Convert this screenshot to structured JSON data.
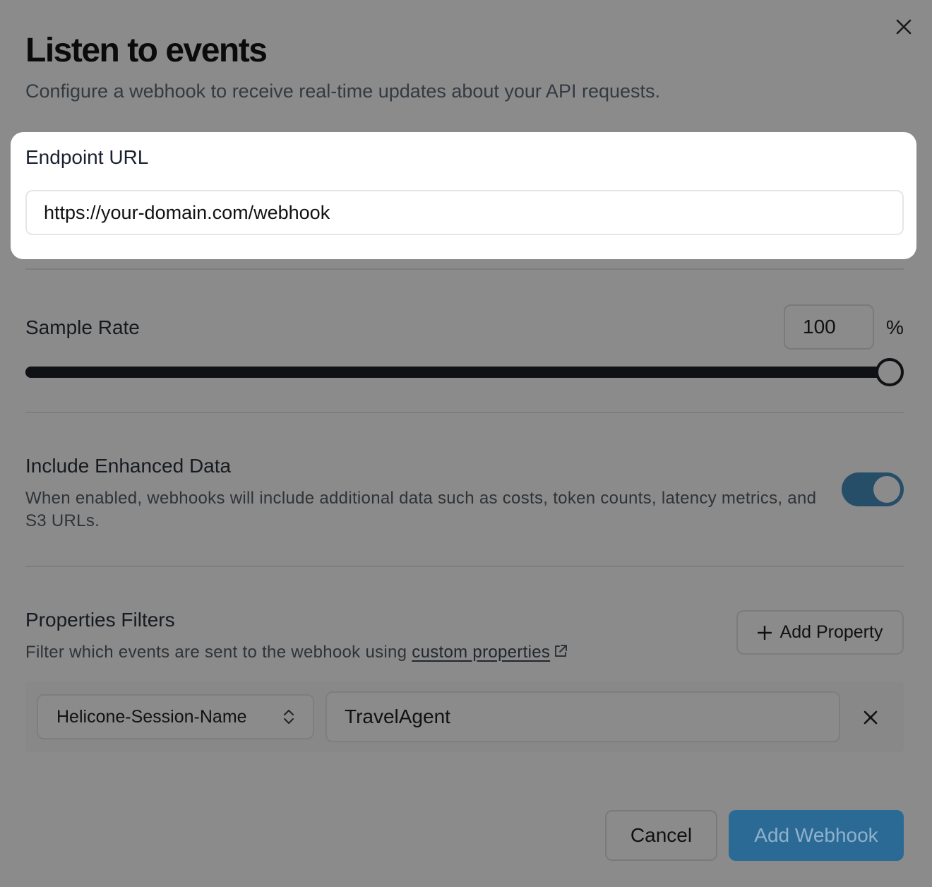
{
  "dialog": {
    "title": "Listen to events",
    "subtitle": "Configure a webhook to receive real-time updates about your API requests.",
    "close_icon": "close-icon"
  },
  "endpoint": {
    "label": "Endpoint URL",
    "value": "https://your-domain.com/webhook"
  },
  "sample_rate": {
    "label": "Sample Rate",
    "value": "100",
    "unit": "%",
    "slider_value": 100,
    "slider_max": 100
  },
  "enhanced_data": {
    "label": "Include Enhanced Data",
    "description": "When enabled, webhooks will include additional data such as costs, token counts, latency metrics, and S3 URLs.",
    "enabled": true
  },
  "properties_filters": {
    "label": "Properties Filters",
    "description_prefix": "Filter which events are sent to the webhook using ",
    "link_text": "custom properties",
    "add_button_label": "Add Property",
    "filters": [
      {
        "property": "Helicone-Session-Name",
        "value": "TravelAgent"
      }
    ]
  },
  "footer": {
    "cancel_label": "Cancel",
    "submit_label": "Add Webhook"
  },
  "colors": {
    "overlay": "#8b8b8b",
    "toggle_on": "#264e68",
    "primary_button": "#2c6a96"
  }
}
